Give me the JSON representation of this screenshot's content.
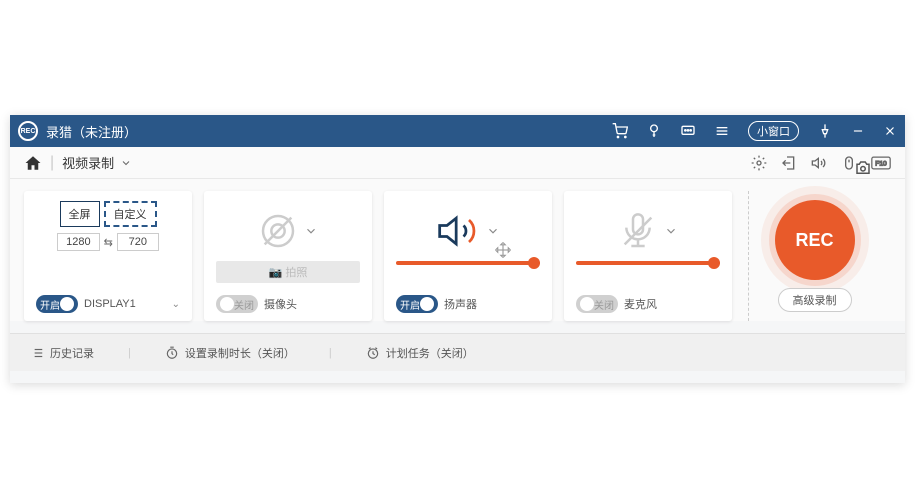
{
  "titlebar": {
    "app_name": "录猎（未注册）",
    "mini_window": "小窗口"
  },
  "toolbar": {
    "tab": "视频录制"
  },
  "card_screen": {
    "fullscreen": "全屏",
    "custom": "自定义",
    "width": "1280",
    "height": "720",
    "toggle": "开启",
    "display": "DISPLAY1"
  },
  "card_camera": {
    "capture": "拍照",
    "toggle": "关闭",
    "label": "摄像头"
  },
  "card_speaker": {
    "toggle": "开启",
    "label": "扬声器"
  },
  "card_mic": {
    "toggle": "关闭",
    "label": "麦克风"
  },
  "rec": {
    "button": "REC",
    "advanced": "高级录制"
  },
  "footer": {
    "history": "历史记录",
    "duration": "设置录制时长（关闭）",
    "schedule": "计划任务（关闭）"
  }
}
